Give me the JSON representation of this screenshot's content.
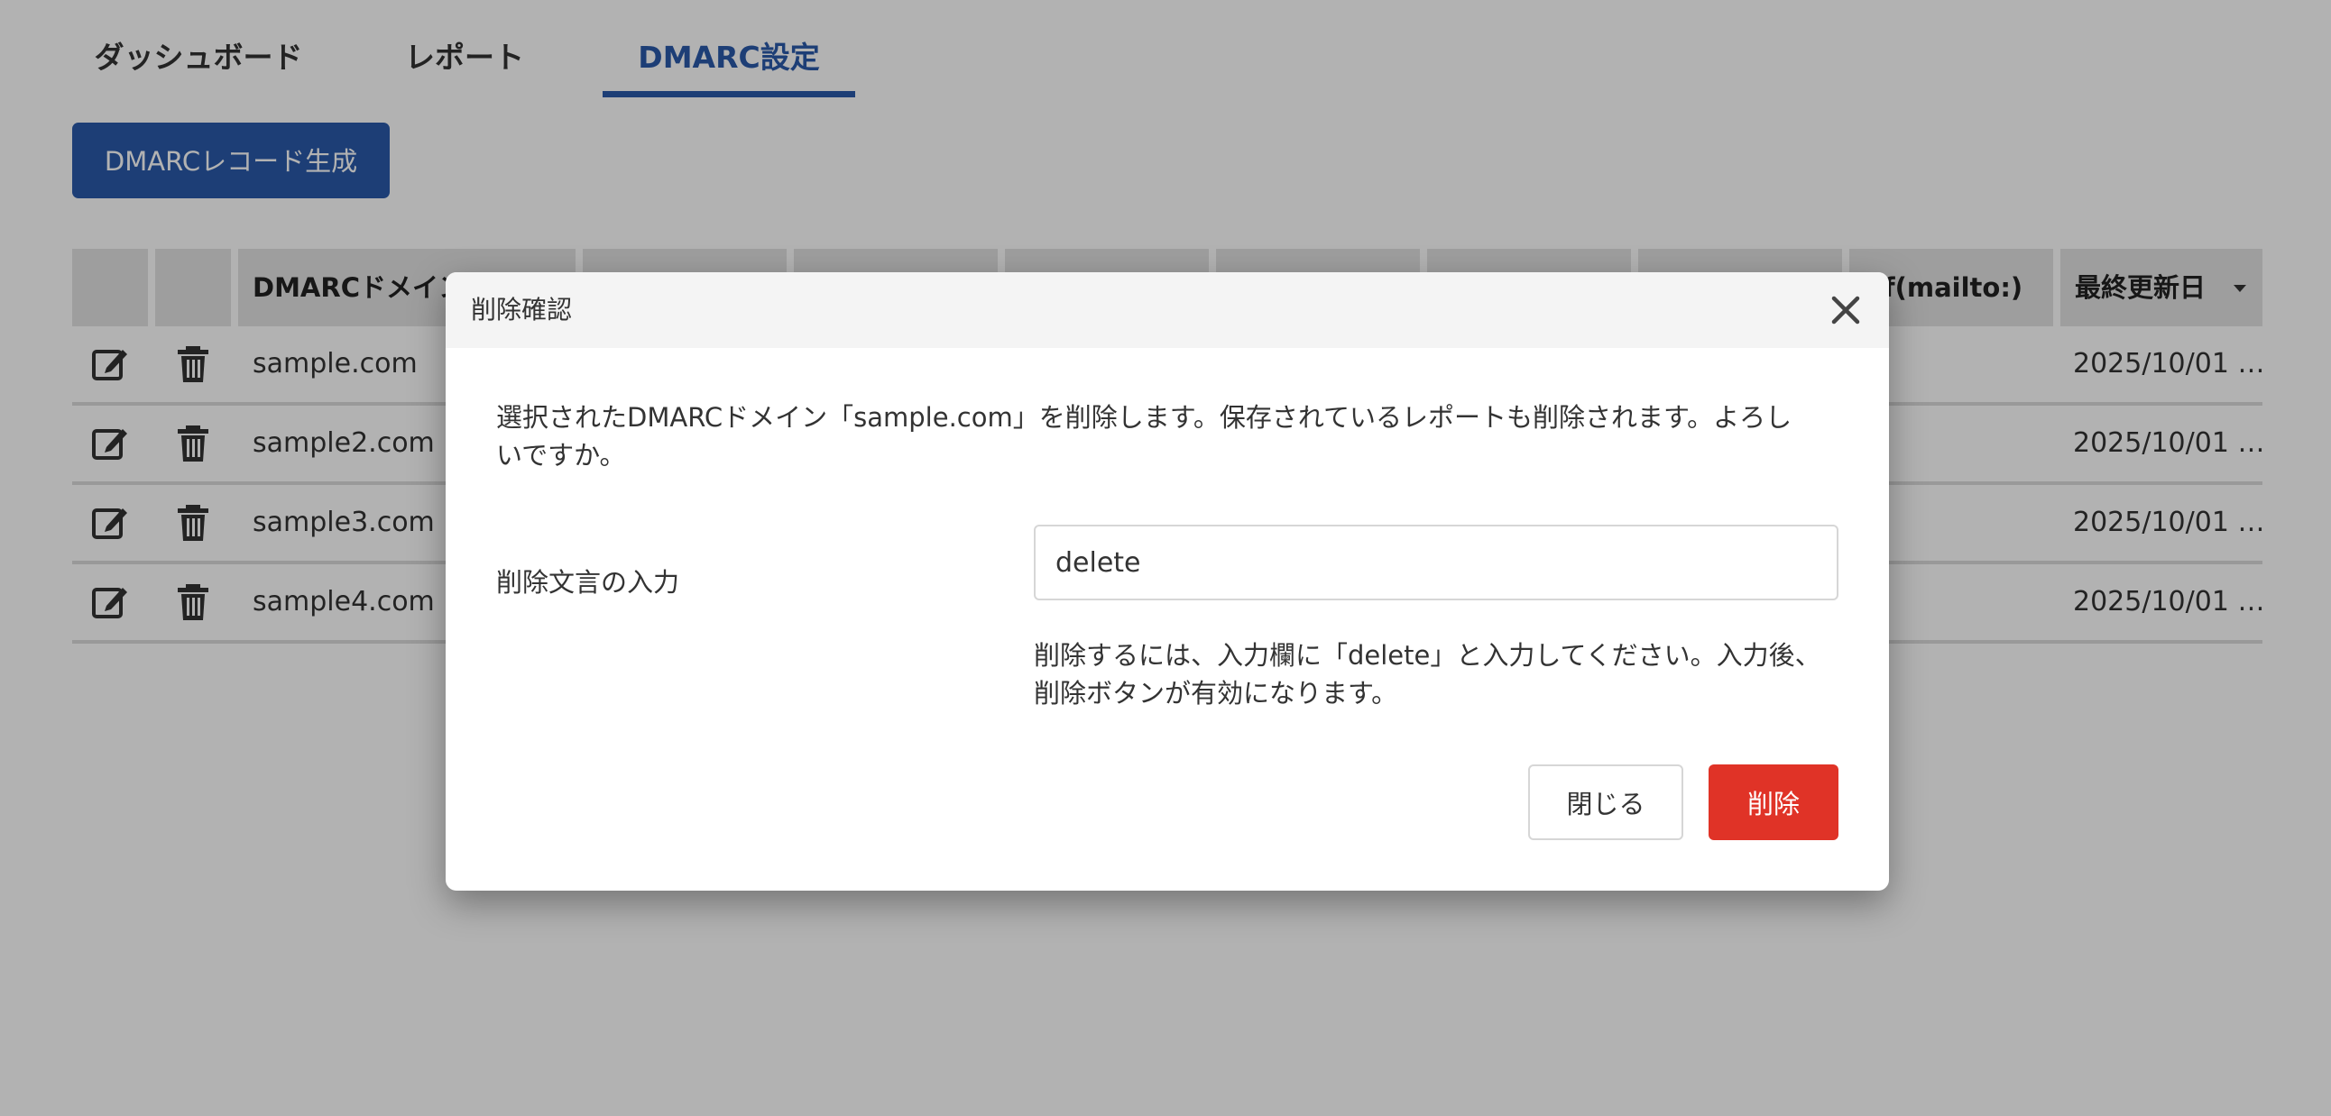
{
  "tabs": [
    {
      "label": "ダッシュボード",
      "active": false
    },
    {
      "label": "レポート",
      "active": false
    },
    {
      "label": "DMARC設定",
      "active": true
    }
  ],
  "generate_button": {
    "label": "DMARCレコード生成"
  },
  "table": {
    "headers": {
      "domain": "DMARCドメイン",
      "rua": "f(mailto:)",
      "updated": "最終更新日"
    },
    "rows": [
      {
        "domain": "sample.com",
        "updated": "2025/10/01 …"
      },
      {
        "domain": "sample2.com",
        "updated": "2025/10/01 …"
      },
      {
        "domain": "sample3.com",
        "updated": "2025/10/01 …"
      },
      {
        "domain": "sample4.com",
        "updated": "2025/10/01 …"
      }
    ]
  },
  "modal": {
    "title": "削除確認",
    "message": "選択されたDMARCドメイン「sample.com」を削除します。保存されているレポートも削除されます。よろしいですか。",
    "field_label": "削除文言の入力",
    "input_value": "delete",
    "hint": "削除するには、入力欄に「delete」と入力してください。入力後、削除ボタンが有効になります。",
    "close_label": "閉じる",
    "delete_label": "削除"
  },
  "colors": {
    "primary": "#2a5aa9",
    "danger": "#e03327",
    "header_bg": "#e3e3e3"
  }
}
